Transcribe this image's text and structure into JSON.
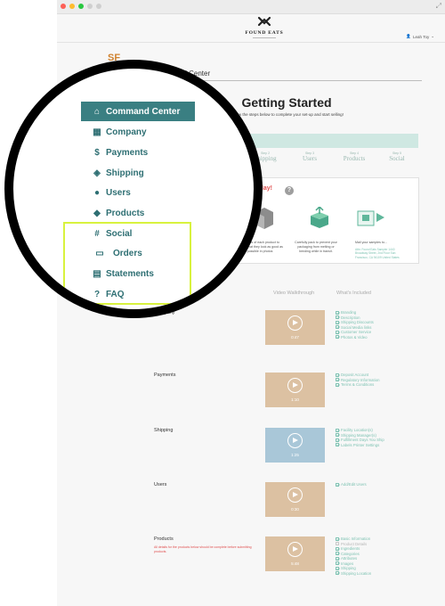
{
  "header": {
    "logo_text": "FOUND EATS",
    "user_name": "Leah Toy",
    "user_caret": "⌄"
  },
  "brand": {
    "initials": "SF"
  },
  "page": {
    "title": "Command Center",
    "heading": "Getting Started",
    "subheading": "Follow the steps below to complete your set-up and start selling!"
  },
  "steps": [
    {
      "number": "Step 2",
      "label": "Shipping"
    },
    {
      "number": "Step 3",
      "label": "Users"
    },
    {
      "number": "Step 4",
      "label": "Products"
    },
    {
      "number": "Step 5",
      "label": "Social"
    }
  ],
  "samples": {
    "title": "ples today!",
    "help_icon": "?",
    "caption_1": "multiples of each product to ensure that they look as good as possible in photos",
    "caption_2": "Carefully pack to prevent your packaging from melting or bending while in transit.",
    "caption_3": "Mail your samples to...",
    "address": "Attn: Found Eats Sampler 1440 Broadway Street, 2nd Floor San Francisco, CA 94109 United States"
  },
  "table": {
    "video_header": "Video Walkthrough",
    "included_header": "What's Included"
  },
  "sections": [
    {
      "name": "Company",
      "duration": "0:47",
      "color": "#dcc1a2",
      "items": [
        "Branding",
        "Description",
        "Shipping Discounts",
        "Social Media links",
        "Customer Service",
        "Photos & Video"
      ]
    },
    {
      "name": "Payments",
      "duration": "1:10",
      "color": "#dcc1a2",
      "items": [
        "Deposit Account",
        "Regulatory Information",
        "Terms & Conditions"
      ]
    },
    {
      "name": "Shipping",
      "duration": "1:25",
      "color": "#a9c7d8",
      "items": [
        "Facility Location(s)",
        "Shipping Manager(s)",
        "Fulfillment Days You Ship",
        "Labels Printer Settings"
      ]
    },
    {
      "name": "Users",
      "duration": "0:30",
      "color": "#dcc1a2",
      "items": [
        "Add/Edit Users"
      ]
    },
    {
      "name": "Products",
      "duration": "5:48",
      "color": "#dcc1a2",
      "note": "All details for the products below should be complete before submitting products.",
      "items": [
        "Basic Information",
        "Product Details",
        "Ingredients",
        "Categories",
        "Attributes",
        "Images",
        "Shipping",
        "Shipping Location"
      ],
      "unchecked_index": 1
    }
  ],
  "nav": {
    "items": [
      {
        "label": "Command Center",
        "icon": "home-icon",
        "active": true
      },
      {
        "label": "Company",
        "icon": "store-icon"
      },
      {
        "label": "Payments",
        "icon": "dollar-icon"
      },
      {
        "label": "Shipping",
        "icon": "box-icon"
      },
      {
        "label": "Users",
        "icon": "user-icon"
      },
      {
        "label": "Products",
        "icon": "cube-icon"
      },
      {
        "label": "Social",
        "icon": "hashtag-icon"
      },
      {
        "label": "Orders",
        "icon": "register-icon"
      },
      {
        "label": "Statements",
        "icon": "document-icon"
      },
      {
        "label": "FAQ",
        "icon": "question-icon"
      }
    ]
  },
  "colors": {
    "accent": "#3a7f82",
    "highlight": "#d8f23e",
    "included_text": "#7fc3b3",
    "alert": "#e05050"
  }
}
